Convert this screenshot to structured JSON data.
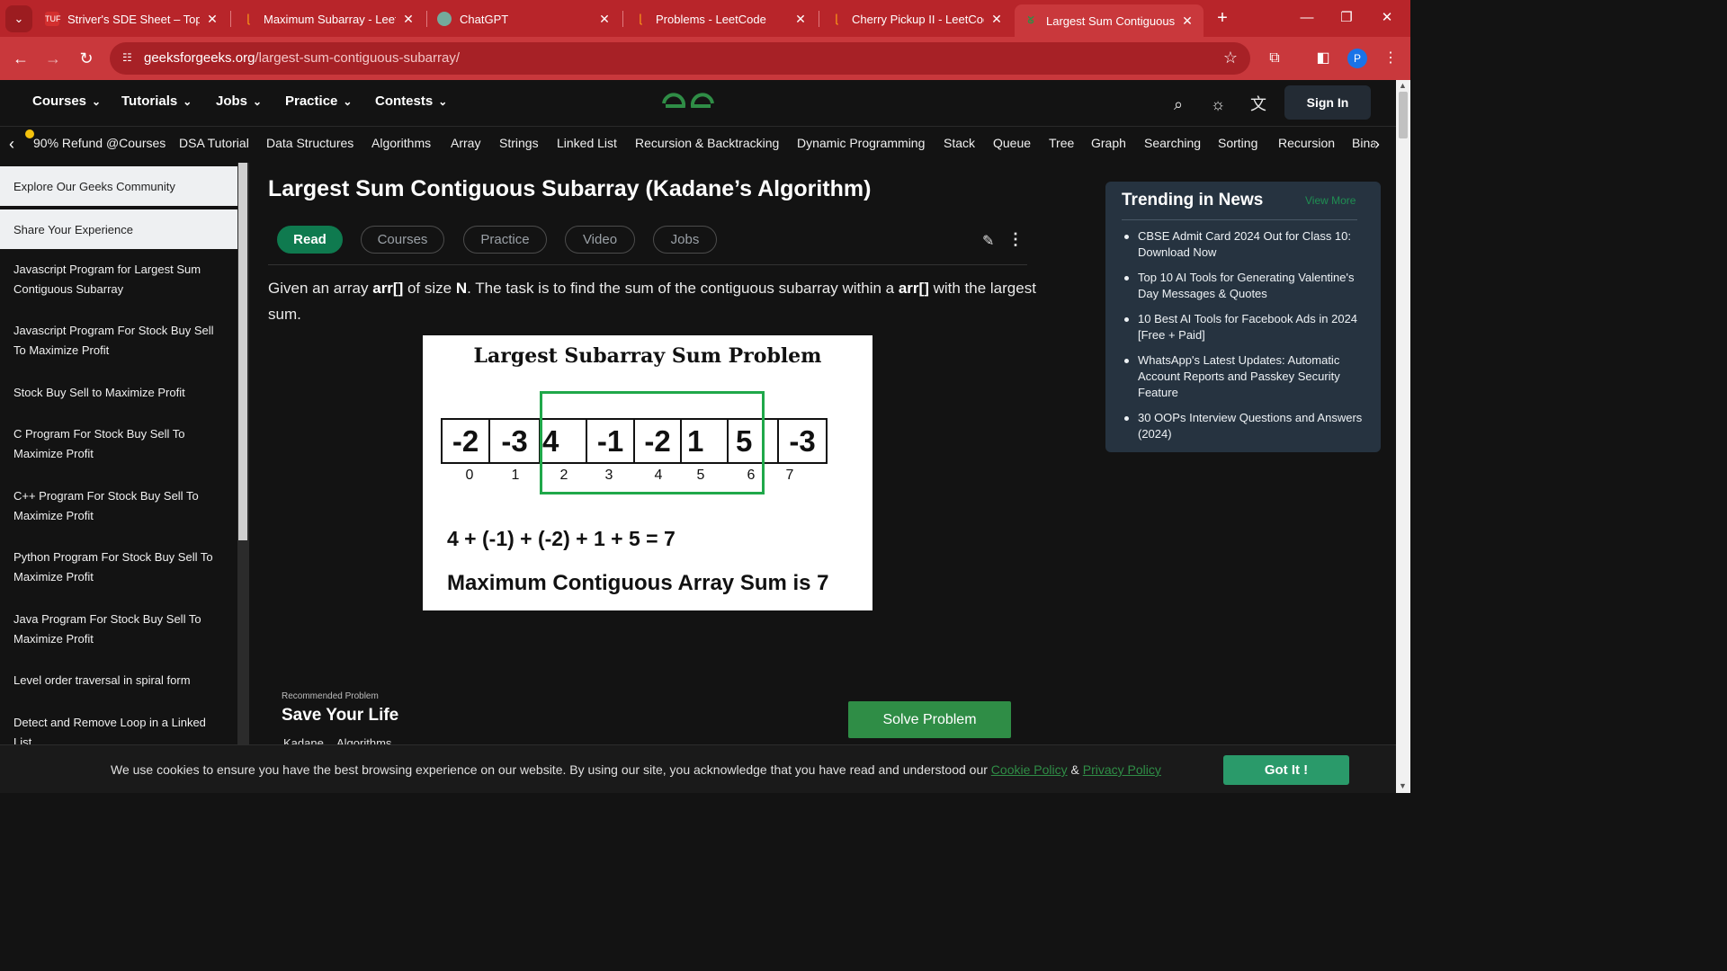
{
  "browser": {
    "tabs": [
      {
        "title": "Striver's SDE Sheet – Top C",
        "favicon": "tuf-icon"
      },
      {
        "title": "Maximum Subarray - LeetC",
        "favicon": "leetcode-icon"
      },
      {
        "title": "ChatGPT",
        "favicon": "chatgpt-icon"
      },
      {
        "title": "Problems - LeetCode",
        "favicon": "leetcode-icon"
      },
      {
        "title": "Cherry Pickup II - LeetCode",
        "favicon": "leetcode-icon"
      },
      {
        "title": "Largest Sum Contiguous Su",
        "favicon": "gfg-icon",
        "active": true
      }
    ],
    "url_domain": "geeksforgeeks.org",
    "url_path": "/largest-sum-contiguous-subarray/",
    "profile_initial": "P",
    "tuf_badge": "TUF"
  },
  "header": {
    "menu": [
      "Courses",
      "Tutorials",
      "Jobs",
      "Practice",
      "Contests"
    ],
    "sign_in": "Sign In"
  },
  "topics": [
    "90% Refund @Courses",
    "DSA Tutorial",
    "Data Structures",
    "Algorithms",
    "Array",
    "Strings",
    "Linked List",
    "Recursion & Backtracking",
    "Dynamic Programming",
    "Stack",
    "Queue",
    "Tree",
    "Graph",
    "Searching",
    "Sorting",
    "Recursion",
    "Bina"
  ],
  "sidebar": {
    "community": "Explore Our Geeks Community",
    "share": "Share Your Experience",
    "items": [
      "Javascript Program for Largest Sum Contiguous Subarray",
      "Javascript Program For Stock Buy Sell To Maximize Profit",
      "Stock Buy Sell to Maximize Profit",
      "C Program For Stock Buy Sell To Maximize Profit",
      "C++ Program For Stock Buy Sell To Maximize Profit",
      "Python Program For Stock Buy Sell To Maximize Profit",
      "Java Program For Stock Buy Sell To Maximize Profit",
      "Level order traversal in spiral form",
      "Detect and Remove Loop in a Linked List"
    ]
  },
  "article": {
    "title": "Largest Sum Contiguous Subarray (Kadane’s Algorithm)",
    "tabs": [
      "Read",
      "Courses",
      "Practice",
      "Video",
      "Jobs"
    ],
    "intro": {
      "p1": "Given an array ",
      "arr": "arr[]",
      "p2": " of size ",
      "n": "N",
      "p3": ". The task is to find the sum of the contiguous subarray within a ",
      "arr2": "arr[]",
      "p4": " with the largest sum."
    },
    "figure": {
      "title": "Largest Subarray Sum Problem",
      "values": [
        "-2",
        "-3",
        "4",
        "-1",
        "-2",
        "1",
        "5",
        "-3"
      ],
      "indices": [
        "0",
        "1",
        "2",
        "3",
        "4",
        "5",
        "6",
        "7"
      ],
      "equation": "4 + (-1) + (-2) + 1 + 5 = 7",
      "result": "Maximum Contiguous Array Sum is 7",
      "highlight_color": "#20a84a"
    },
    "recommended": {
      "label": "Recommended Problem",
      "title": "Save Your Life",
      "tags": [
        "Kadane",
        "Algorithms"
      ],
      "button": "Solve Problem"
    }
  },
  "trending": {
    "title": "Trending in News",
    "view_more": "View More",
    "items": [
      "CBSE Admit Card 2024 Out for Class 10: Download Now",
      "Top 10 AI Tools for Generating Valentine's Day Messages & Quotes",
      "10 Best AI Tools for Facebook Ads in 2024 [Free + Paid]",
      "WhatsApp's Latest Updates: Automatic Account Reports and Passkey Security Feature",
      "30 OOPs Interview Questions and Answers (2024)"
    ]
  },
  "cookie": {
    "text": "We use cookies to ensure you have the best browsing experience on our website. By using our site, you acknowledge that you have read and understood our ",
    "policy": "Cookie Policy",
    "amp": " & ",
    "privacy": "Privacy Policy",
    "button": "Got It !"
  },
  "colors": {
    "chrome": "#c9383c",
    "gfg_green": "#2f8d46",
    "read_pill": "#0f7a4f"
  }
}
